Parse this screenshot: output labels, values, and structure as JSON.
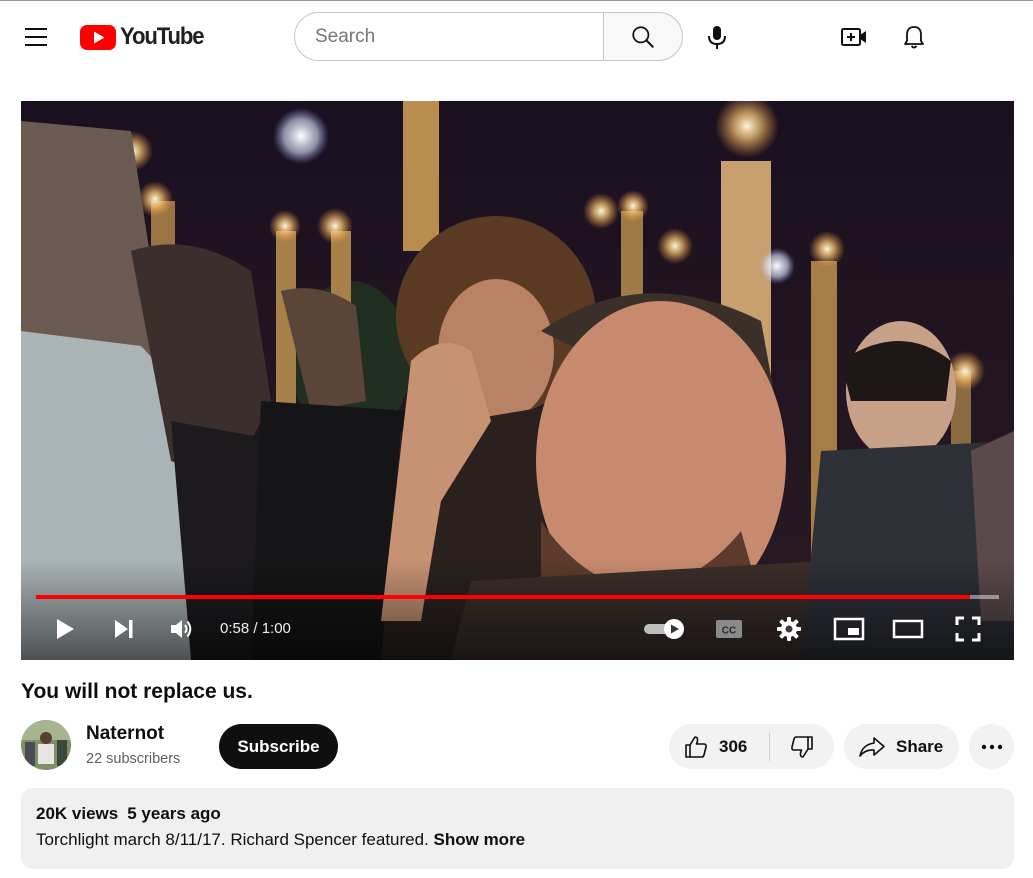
{
  "masthead": {
    "logo_text": "YouTube",
    "search_placeholder": "Search",
    "icons": [
      "menu-icon",
      "search-icon",
      "mic-icon",
      "create-video-icon",
      "bell-icon"
    ]
  },
  "player": {
    "current_time": "0:58",
    "duration": "1:00",
    "time_display": "0:58 / 1:00",
    "progress_fraction": 0.97,
    "autoplay_on": true,
    "icons": [
      "play-icon",
      "next-icon",
      "volume-icon",
      "autoplay-toggle-icon",
      "captions-icon",
      "settings-icon",
      "miniplayer-icon",
      "theater-icon",
      "fullscreen-icon"
    ]
  },
  "video": {
    "title": "You will not replace us."
  },
  "channel": {
    "name": "Naternot",
    "subscribers": "22 subscribers",
    "subscribe_label": "Subscribe"
  },
  "actions": {
    "like_count": "306",
    "share_label": "Share"
  },
  "description": {
    "views": "20K views",
    "age": "5 years ago",
    "text": "Torchlight march 8/11/17. Richard Spencer featured.",
    "show_more": "Show more"
  },
  "colors": {
    "brand_red": "#ff0000",
    "progress_red": "#ff0000",
    "subscribe_bg": "#0f0f0f",
    "pill_bg": "#f2f2f2"
  }
}
